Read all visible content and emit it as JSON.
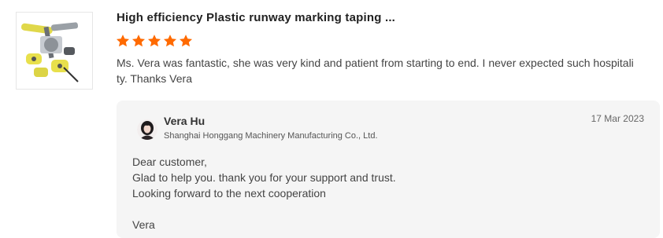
{
  "review": {
    "product_title": "High efficiency Plastic runway marking taping ...",
    "rating": 5,
    "star_color": "#ff6a00",
    "text": "Ms. Vera was fantastic, she was very kind and patient from starting to end. I never expected such hospitality. Thanks Vera"
  },
  "reply": {
    "name": "Vera Hu",
    "company": "Shanghai Honggang Machinery Manufacturing Co., Ltd.",
    "date": "17 Mar 2023",
    "lines": [
      "Dear customer,",
      "Glad to help you. thank you for your support and trust.",
      "Looking forward to the next cooperation",
      "",
      "Vera"
    ]
  }
}
